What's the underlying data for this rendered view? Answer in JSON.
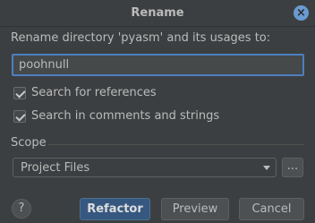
{
  "dialog": {
    "title": "Rename",
    "prompt": "Rename directory 'pyasm' and its usages to:",
    "new_name_value": "poohnull"
  },
  "options": {
    "search_references": {
      "label": "Search for references",
      "checked": true
    },
    "search_comments": {
      "label": "Search in comments and strings",
      "checked": true
    }
  },
  "scope": {
    "label": "Scope",
    "selected": "Project Files",
    "more_label": "..."
  },
  "buttons": {
    "help": "?",
    "refactor": "Refactor",
    "preview": "Preview",
    "cancel": "Cancel"
  },
  "icons": {
    "close": "close-icon",
    "dropdown": "chevron-down-icon"
  },
  "colors": {
    "background": "#3c3f41",
    "accent": "#4d7fbf",
    "primary_button": "#365880"
  }
}
